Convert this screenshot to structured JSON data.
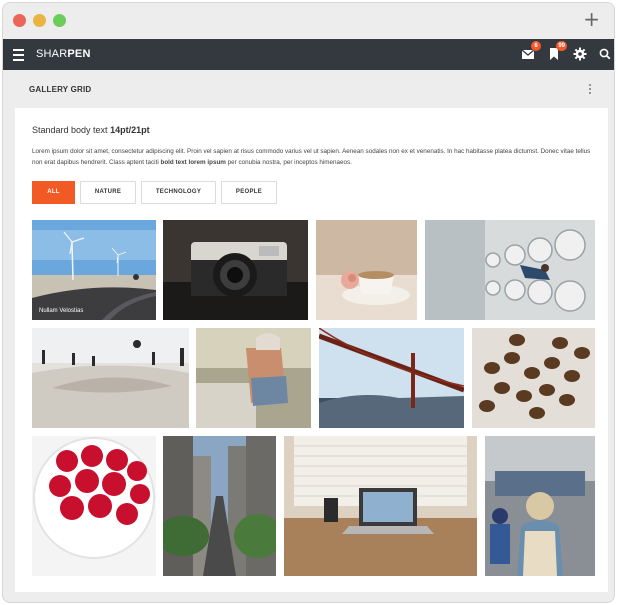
{
  "window": {
    "controls": [
      "close",
      "minimize",
      "maximize"
    ],
    "new_tab_icon": "plus-icon"
  },
  "app": {
    "brand_light": "SHAR",
    "brand_bold": "PEN",
    "icons": {
      "menu": "hamburger-icon",
      "mail": "mail-icon",
      "bookmark": "bookmark-icon",
      "settings": "gear-icon",
      "search": "search-icon"
    },
    "mail_badge": "6",
    "bookmark_badge": "99",
    "accent_color": "#f15a24",
    "bar_color": "#33393e"
  },
  "page": {
    "title": "GALLERY GRID",
    "more_icon": "more-vertical-icon",
    "heading_plain": "Standard body text ",
    "heading_bold": "14pt/21pt",
    "body_text_1": "Lorem ipsum dolor sit amet, consectetur adipiscing elit. Proin vel sapien at risus commodo varius vel ut sapien. Aenean sodales non ex et venenatis. In hac habitasse platea dictumst. Donec vitae tellus non erat dapibus hendrerit. Class aptent taciti ",
    "body_text_bold": "bold text lorem ipsum",
    "body_text_2": " per conubia nostra, per inceptos himenaeos."
  },
  "filters": [
    {
      "label": "ALL",
      "active": true
    },
    {
      "label": "NATURE",
      "active": false
    },
    {
      "label": "TECHNOLOGY",
      "active": false
    },
    {
      "label": "PEOPLE",
      "active": false
    }
  ],
  "gallery": [
    {
      "subject": "wind turbines road",
      "caption": "Nullam Velostias"
    },
    {
      "subject": "vintage camera",
      "caption": ""
    },
    {
      "subject": "coffee cup rose",
      "caption": ""
    },
    {
      "subject": "laundromat",
      "caption": ""
    },
    {
      "subject": "skatepark",
      "caption": ""
    },
    {
      "subject": "woman by car",
      "caption": ""
    },
    {
      "subject": "golden gate bridge",
      "caption": ""
    },
    {
      "subject": "coffee beans",
      "caption": ""
    },
    {
      "subject": "raspberries bowl",
      "caption": ""
    },
    {
      "subject": "city street",
      "caption": ""
    },
    {
      "subject": "laptop desk",
      "caption": ""
    },
    {
      "subject": "street crowd",
      "caption": ""
    }
  ]
}
